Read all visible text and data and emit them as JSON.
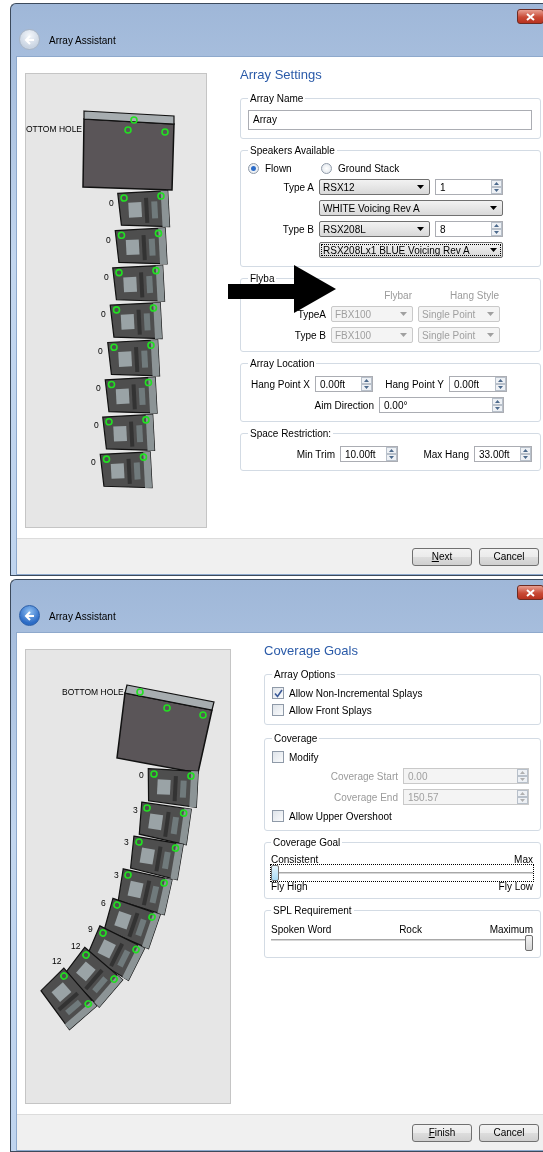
{
  "windows": [
    {
      "title": "Array Assistant",
      "back_enabled": false,
      "canvas": {
        "hole_label": "OTTOM HOLE",
        "splays": [
          "0",
          "0",
          "0",
          "0",
          "0",
          "0",
          "0",
          "0"
        ]
      },
      "page": {
        "kind": "settings",
        "heading": "Array Settings",
        "array_name": {
          "legend": "Array Name",
          "value": "Array"
        },
        "speakers": {
          "legend": "Speakers Available",
          "mount_options": [
            {
              "label": "Flown",
              "selected": true
            },
            {
              "label": "Ground Stack",
              "selected": false
            }
          ],
          "types": [
            {
              "label": "Type A",
              "model": "RSX12",
              "count": "1",
              "voicing": "WHITE Voicing Rev A",
              "focused": false
            },
            {
              "label": "Type B",
              "model": "RSX208L",
              "count": "8",
              "voicing": "RSX208Lx1 BLUE Voicing Rev A",
              "focused": true
            }
          ]
        },
        "flybar": {
          "legend": "Flyba",
          "disabled": true,
          "columns": [
            "Flybar",
            "Hang Style"
          ],
          "rows": [
            {
              "label": "TypeA",
              "flybar": "FBX100",
              "hang_style": "Single Point"
            },
            {
              "label": "Type B",
              "flybar": "FBX100",
              "hang_style": "Single Point"
            }
          ]
        },
        "location": {
          "legend": "Array Location",
          "fields": [
            {
              "label": "Hang Point X",
              "value": "0.00ft"
            },
            {
              "label": "Hang Point Y",
              "value": "0.00ft"
            },
            {
              "label": "Aim Direction",
              "value": "0.00°"
            }
          ]
        },
        "space": {
          "legend": "Space Restriction:",
          "fields": [
            {
              "label": "Min Trim",
              "value": "10.00ft"
            },
            {
              "label": "Max Hang",
              "value": "33.00ft"
            }
          ]
        }
      },
      "buttons": [
        "Next",
        "Cancel"
      ]
    },
    {
      "title": "Array Assistant",
      "back_enabled": true,
      "canvas": {
        "hole_label": "BOTTOM HOLE",
        "splays": [
          "0",
          "3",
          "3",
          "3",
          "6",
          "9",
          "12",
          "12"
        ]
      },
      "page": {
        "kind": "coverage",
        "heading": "Coverage Goals",
        "options": {
          "legend": "Array Options",
          "items": [
            {
              "label": "Allow Non-Incremental Splays",
              "checked": true
            },
            {
              "label": "Allow Front Splays",
              "checked": false
            }
          ]
        },
        "coverage": {
          "legend": "Coverage",
          "modify": {
            "label": "Modify",
            "checked": false
          },
          "fields": [
            {
              "label": "Coverage Start",
              "value": "0.00",
              "disabled": true
            },
            {
              "label": "Coverage End",
              "value": "150.57",
              "disabled": true
            }
          ],
          "overshoot": {
            "label": "Allow Upper Overshoot",
            "checked": false
          }
        },
        "goal": {
          "legend": "Coverage Goal",
          "top_labels": [
            "Consistent",
            "Max"
          ],
          "bottom_labels": [
            "Fly High",
            "Fly Low"
          ],
          "level": 0,
          "focused": true
        },
        "spl": {
          "legend": "SPL Requirement",
          "labels": [
            "Spoken Word",
            "Rock",
            "Maximum"
          ],
          "level": 1
        }
      },
      "buttons": [
        "Finish",
        "Cancel"
      ]
    }
  ]
}
